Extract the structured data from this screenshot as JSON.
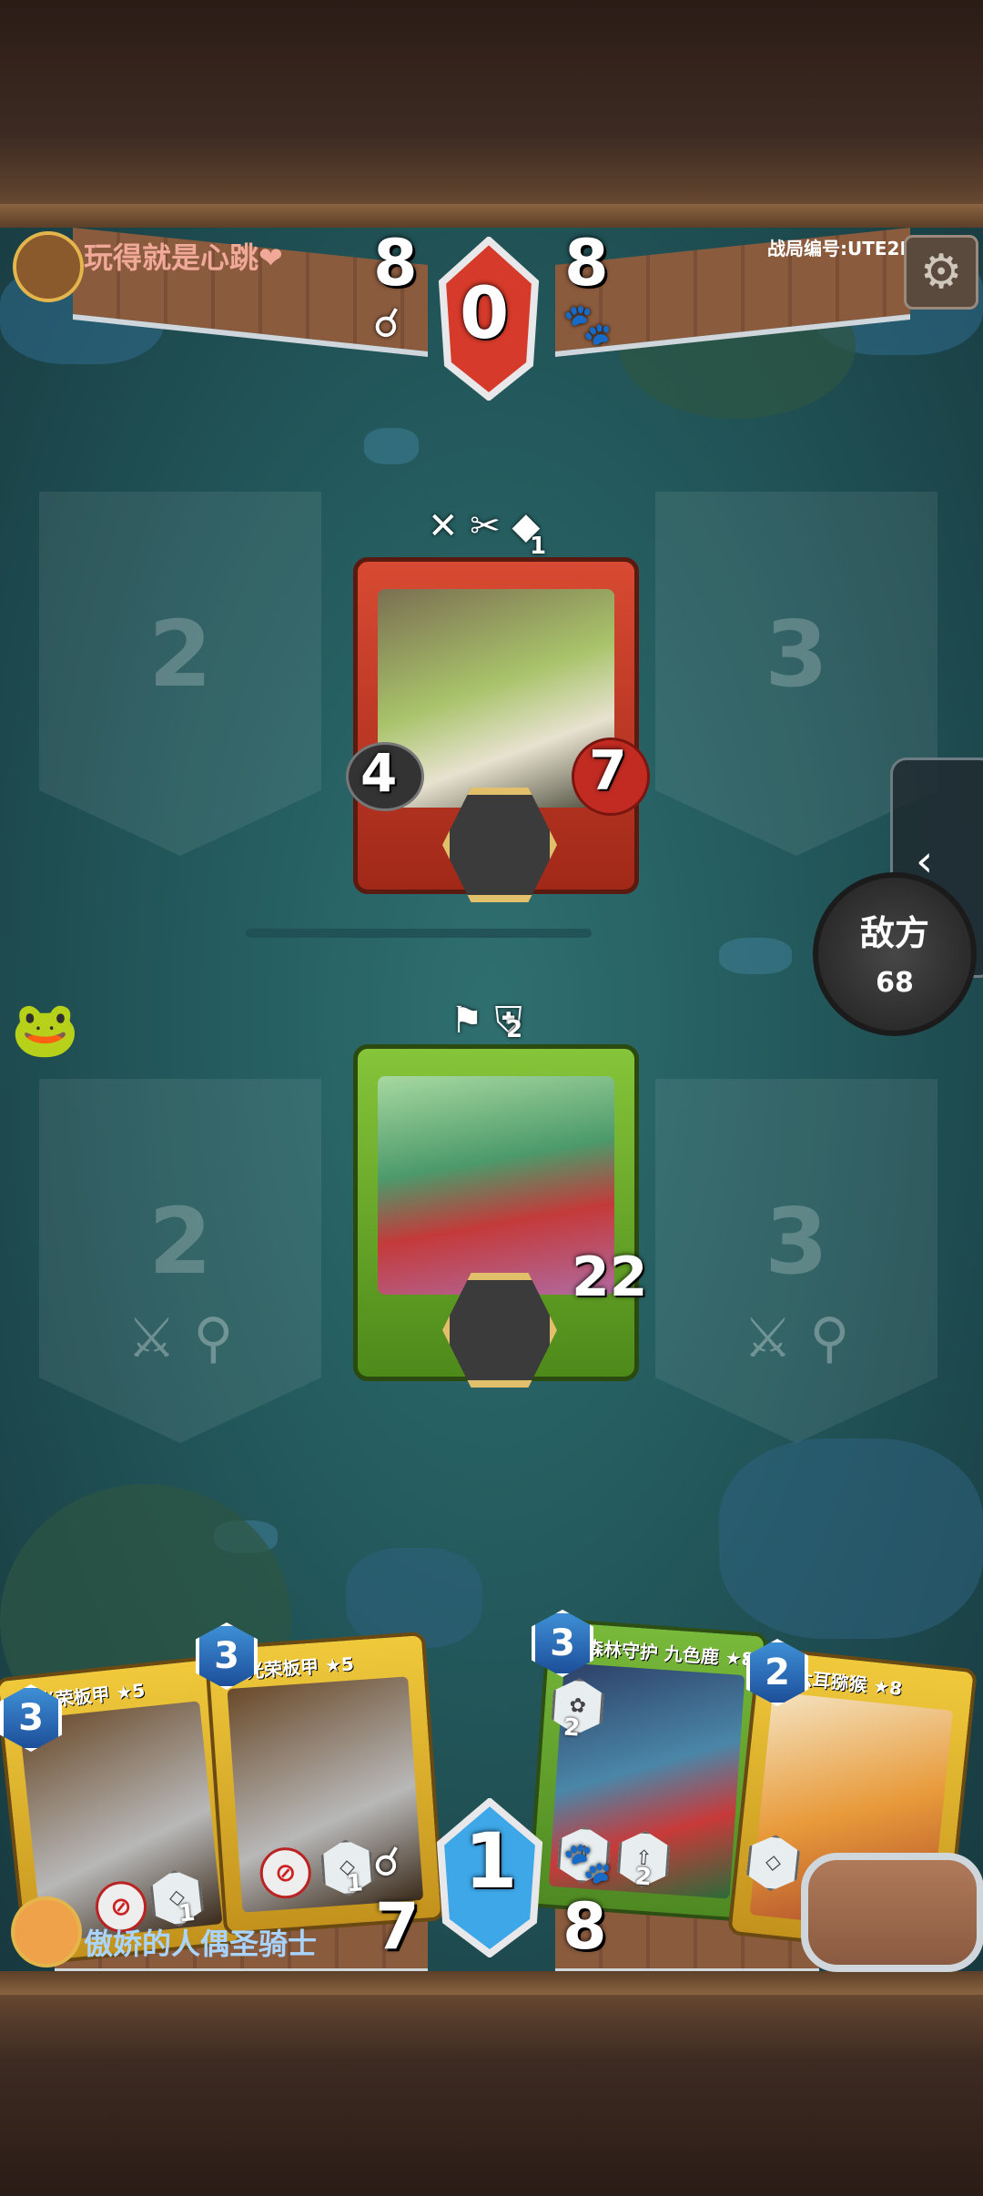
{
  "opponent": {
    "name": "玩得就是心跳❤",
    "left_score": "8",
    "right_score": "8",
    "center_value": "0",
    "left_icon": "ring-icon",
    "right_icon": "paw-icon"
  },
  "match": {
    "id_label": "战局编号:UTE2L"
  },
  "enemy_panel": {
    "label": "敌方",
    "count": "68"
  },
  "slots": {
    "top_left": "2",
    "top_right": "3",
    "bottom_left": "2",
    "bottom_right": "3"
  },
  "enemy_unit": {
    "attack": "4",
    "health": "7",
    "status_count": "1",
    "frame_color": "#c0392b"
  },
  "player_unit": {
    "health": "22",
    "status_count": "2",
    "frame_color": "#6aa82a"
  },
  "player": {
    "name": "傲娇的人偶圣骑士",
    "left_score": "7",
    "right_score": "8",
    "center_value": "1"
  },
  "hand": [
    {
      "title": "光荣板甲 ★5",
      "cost": "3",
      "badge_num": "1"
    },
    {
      "title": "光荣板甲 ★5",
      "cost": "3",
      "badge_num": "1"
    },
    {
      "title": "森林守护 九色鹿 ★8",
      "cost": "3",
      "badge_top": "2",
      "badge_num": "2"
    },
    {
      "title": "六耳猕猴 ★8",
      "cost": "2"
    }
  ],
  "colors": {
    "opponent_name": "#f0a898",
    "player_name": "#a9d4ff",
    "gem_red": "#d63a2a",
    "gem_blue": "#3ea7e8"
  }
}
